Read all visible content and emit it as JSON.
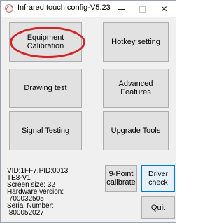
{
  "window": {
    "title": "Infrared touch config-V5.23",
    "app_icon": "app-icon",
    "controls": {
      "minimize_icon": "minimize-icon",
      "maximize_icon": "maximize-icon",
      "close_icon": "close-icon",
      "close_glyph": "✕"
    }
  },
  "buttons": {
    "equipment_calibration": "Equipment Calibration",
    "hotkey_setting": "Hotkey setting",
    "drawing_test": "Drawing test",
    "advanced_features": "Advanced Features",
    "signal_testing": "Signal Testing",
    "upgrade_tools": "Upgrade Tools",
    "nine_point_line1": "9-Point",
    "nine_point_line2": "calibrate",
    "driver_check": "Driver check",
    "quit": "Quit"
  },
  "device_info": {
    "vid_pid": "VID:1FF7,PID:0013",
    "model": "TE8-V1",
    "screen_size": "Screen size: 32",
    "hardware_label": "Hardware version:",
    "hardware_value": " 700032505",
    "serial_label": "Serial Number:",
    "serial_value": " 800052027"
  },
  "colors": {
    "annotation": "#d42525",
    "focus_border": "#0078d7",
    "button_face": "#e1e1e1"
  }
}
